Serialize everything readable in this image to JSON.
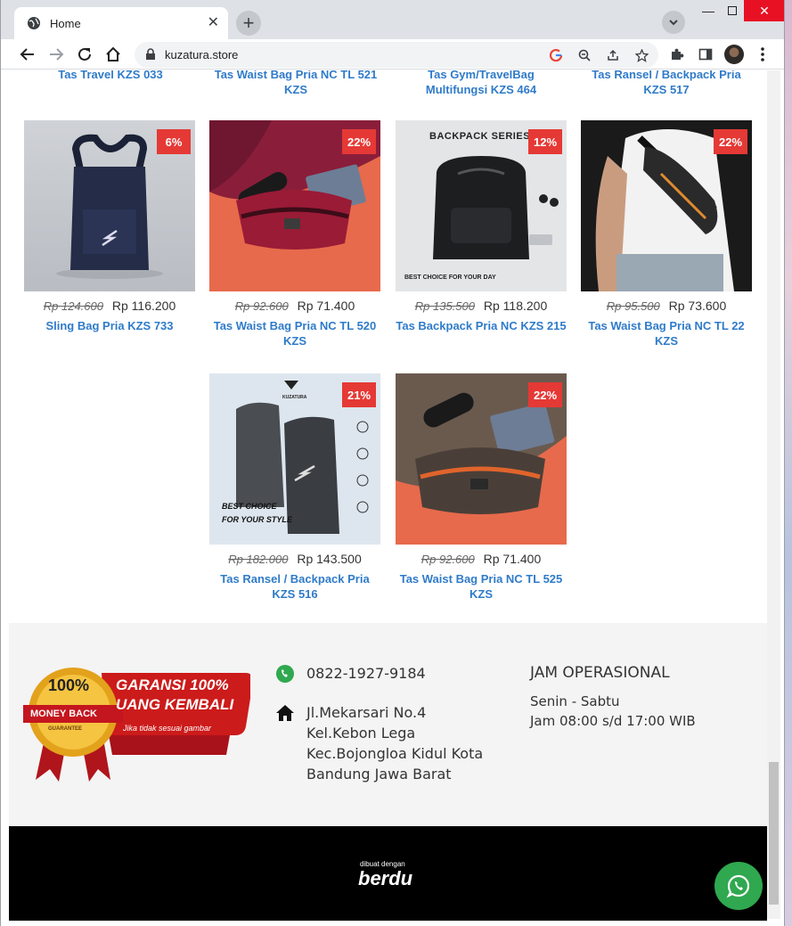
{
  "browser": {
    "tab_title": "Home",
    "url": "kuzatura.store"
  },
  "top_row_titles": [
    [
      "Tas Travel KZS 033",
      ""
    ],
    [
      "Tas Waist Bag Pria NC TL 521",
      "KZS"
    ],
    [
      "Tas Gym/TravelBag",
      "Multifungsi KZS 464"
    ],
    [
      "Tas Ransel / Backpack Pria",
      "KZS 517"
    ]
  ],
  "products": [
    {
      "badge": "6%",
      "old_price": "Rp 124.600",
      "price": "Rp 116.200",
      "name": "Sling Bag Pria KZS 733"
    },
    {
      "badge": "22%",
      "old_price": "Rp 92.600",
      "price": "Rp 71.400",
      "name": "Tas Waist Bag Pria NC TL 520 KZS"
    },
    {
      "badge": "12%",
      "old_price": "Rp 135.500",
      "price": "Rp 118.200",
      "name": "Tas Backpack Pria NC KZS 215",
      "img_text_top": "BACKPACK SERIES",
      "img_text_bottom": "BEST CHOICE FOR YOUR DAY"
    },
    {
      "badge": "22%",
      "old_price": "Rp 95.500",
      "price": "Rp 73.600",
      "name": "Tas Waist Bag Pria NC TL 22 KZS"
    },
    {
      "badge": "21%",
      "old_price": "Rp 182.000",
      "price": "Rp 143.500",
      "name": "Tas Ransel / Backpack Pria KZS 516",
      "img_text_brand": "KUZATURA",
      "img_text_line1": "BEST CHOICE",
      "img_text_line2": "FOR YOUR STYLE"
    },
    {
      "badge": "22%",
      "old_price": "Rp 92.600",
      "price": "Rp 71.400",
      "name": "Tas Waist Bag Pria NC TL 525 KZS"
    }
  ],
  "footer": {
    "guarantee": {
      "seal_top": "100%",
      "seal_mid": "MONEY BACK",
      "seal_bottom": "GUARANTEE",
      "line1": "GARANSI 100%",
      "line2": "UANG KEMBALI",
      "note": "Jika tidak sesuai gambar"
    },
    "phone": "0822-1927-9184",
    "address_lines": [
      "Jl.Mekarsari No.4",
      "Kel.Kebon Lega",
      "Kec.Bojongloa Kidul Kota",
      "Bandung Jawa Barat"
    ],
    "hours_title": "JAM OPERASIONAL",
    "hours_days": "Senin - Sabtu",
    "hours_time": "Jam 08:00 s/d 17:00 WIB"
  },
  "credit": {
    "small": "dibuat dengan",
    "brand": "berdu"
  },
  "colors": {
    "badge": "#e53935",
    "link": "#2f7bc9",
    "whatsapp": "#2fa84f"
  }
}
